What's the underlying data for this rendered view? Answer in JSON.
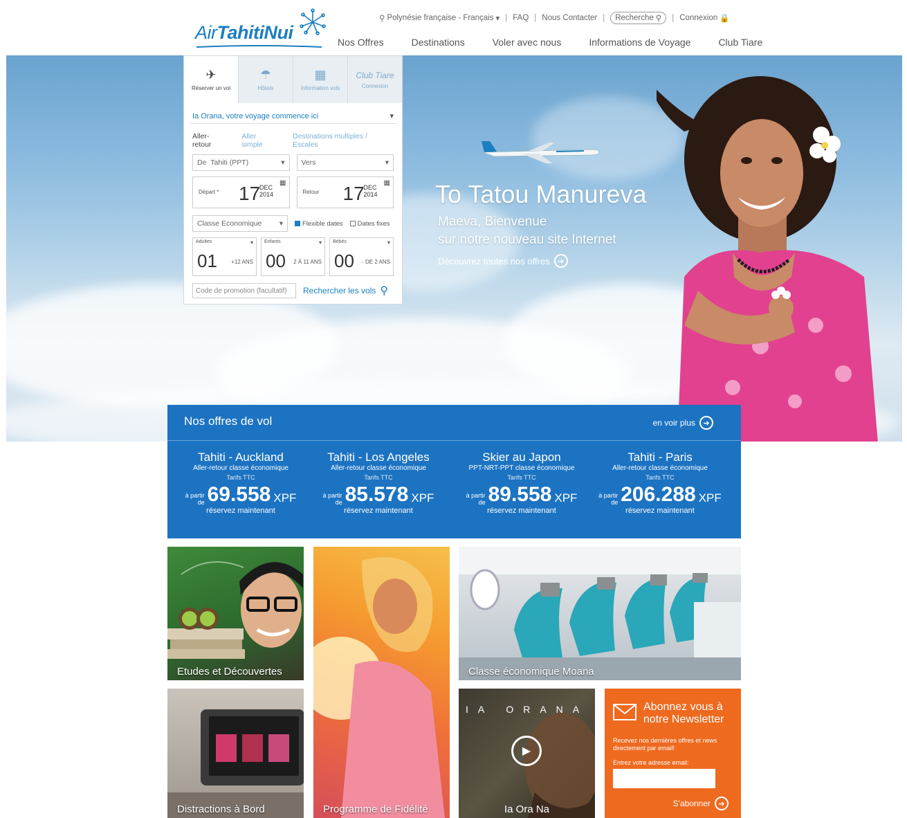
{
  "brand": {
    "name_air": "Air",
    "name_rest": "TahitiNui",
    "color": "#1a7fc0"
  },
  "topbar": {
    "location": "Polynésie française - Français",
    "faq": "FAQ",
    "contact": "Nous Contacter",
    "search": "Recherche",
    "login": "Connexion"
  },
  "nav": [
    "Nos Offres",
    "Destinations",
    "Voler avec nous",
    "Informations de Voyage",
    "Club Tiare"
  ],
  "hero": {
    "title": "To Tatou Manureva",
    "subtitle_1": "Maeva, Bienvenue",
    "subtitle_2": "sur notre nouveau site Internet",
    "link": "Découvrez toutes nos offres"
  },
  "widget": {
    "tabs": [
      {
        "label": "Réserver un vol",
        "icon": "plane-icon"
      },
      {
        "label": "Hôtels",
        "icon": "umbrella-icon"
      },
      {
        "label": "Information vols",
        "icon": "calendar-icon"
      },
      {
        "label": "Connexion",
        "icon": "club-tiare-icon",
        "title": "Club Tiare"
      }
    ],
    "greeting": "Ia Orana, votre voyage commence ici",
    "trip_types": [
      "Aller-retour",
      "Aller simple",
      "Destinations multiples / Escales"
    ],
    "from_label": "De",
    "from_value": "Tahiti (PPT)",
    "to_placeholder": "Vers",
    "depart": {
      "label": "Départ *",
      "day": "17",
      "month": "DEC",
      "year": "2014"
    },
    "return": {
      "label": "Retour",
      "day": "17",
      "month": "DEC",
      "year": "2014"
    },
    "cabin": "Classe Economique",
    "flexible": "Flexible dates",
    "fixed": "Dates fixes",
    "pax": [
      {
        "label": "Adultes",
        "value": "01",
        "note": "+12 ANS"
      },
      {
        "label": "Enfants",
        "value": "00",
        "note": "2 À 11 ANS"
      },
      {
        "label": "Bébés",
        "value": "00",
        "note": "- DE 2 ANS"
      }
    ],
    "promo_placeholder": "Code de promotion (facultatif)",
    "search_btn": "Rechercher les vols"
  },
  "offers": {
    "title": "Nos offres de vol",
    "more": "en voir plus",
    "items": [
      {
        "route": "Tahiti - Auckland",
        "cls": "Aller-retour classe économique",
        "ttc": "Tarifs TTC",
        "from_1": "à partir",
        "from_2": "de",
        "amount": "69.558",
        "currency": "XPF",
        "book": "réservez maintenant"
      },
      {
        "route": "Tahiti - Los Angeles",
        "cls": "Aller-retour classe économique",
        "ttc": "Tarifs TTC",
        "from_1": "à partir",
        "from_2": "de",
        "amount": "85.578",
        "currency": "XPF",
        "book": "réservez maintenant"
      },
      {
        "route": "Skier au Japon",
        "cls": "PPT-NRT-PPT classe économique",
        "ttc": "Tarifs TTC",
        "from_1": "à partir",
        "from_2": "de",
        "amount": "89.558",
        "currency": "XPF",
        "book": "réservez maintenant"
      },
      {
        "route": "Tahiti - Paris",
        "cls": "Aller-retour classe économique",
        "ttc": "Tarifs TTC",
        "from_1": "à partir",
        "from_2": "de",
        "amount": "206.288",
        "currency": "XPF",
        "book": "réservez maintenant"
      }
    ]
  },
  "tiles": {
    "etudes": "Etudes et Découvertes",
    "moana": "Classe économique Moana",
    "distractions": "Distractions à Bord",
    "fidelite": "Programme de Fidélité",
    "iaora_brand": "IA ORANA",
    "iaora": "Ia Ora Na"
  },
  "newsletter": {
    "title_1": "Abonnez vous à",
    "title_2": "notre Newsletter",
    "desc": "Recevez nos dernières offres et news directement par email!",
    "label": "Entrez votre adresse email:",
    "button": "S'abonner"
  }
}
